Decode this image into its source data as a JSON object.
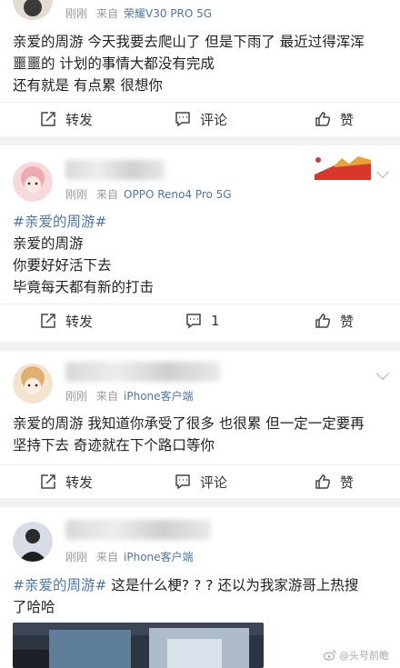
{
  "post1": {
    "time": "刚刚",
    "from": "来自",
    "device": "荣耀V30 PRO 5G",
    "lines": [
      "亲爱的周游 今天我要去爬山了 但是下雨了 最近过得浑浑",
      "噩噩的 计划的事情大都没有完成",
      "还有就是 有点累 很想你"
    ],
    "actions": {
      "repost": "转发",
      "comment": "评论",
      "like": "赞"
    }
  },
  "post2": {
    "time": "刚刚",
    "from": "来自",
    "device": "OPPO Reno4 Pro 5G",
    "topic": "#亲爱的周游#",
    "lines": [
      "亲爱的周游",
      "你要好好活下去",
      "毕竟每天都有新的打击"
    ],
    "actions": {
      "repost": "转发",
      "comment_count": "1",
      "like": "赞"
    }
  },
  "post3": {
    "time": "刚刚",
    "from": "来自",
    "device": "iPhone客户端",
    "lines": [
      "亲爱的周游 我知道你承受了很多 也很累 但一定一定要再",
      "坚持下去 奇迹就在下个路口等你"
    ],
    "actions": {
      "repost": "转发",
      "comment": "评论",
      "like": "赞"
    }
  },
  "post4": {
    "time": "刚刚",
    "from": "来自",
    "device": "iPhone客户端",
    "topic": "#亲爱的周游#",
    "line1_rest": " 这是什么梗? ? ?  还以为我家游哥上热搜",
    "line2": "了哈哈"
  },
  "watermark": "@头号前瞻",
  "colors": {
    "link": "#4d76a8",
    "meta": "#9a9a9a",
    "background": "#f2f2f2"
  }
}
